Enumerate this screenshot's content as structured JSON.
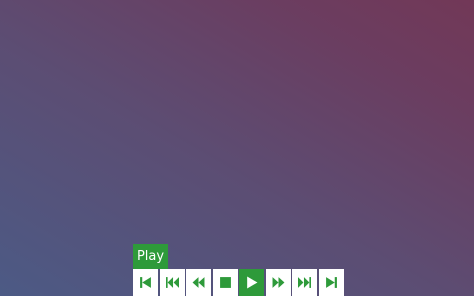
{
  "tooltip": {
    "text": "Play"
  },
  "controls": [
    {
      "name": "skip-to-start-button",
      "icon": "skip-back-icon",
      "active": false
    },
    {
      "name": "previous-track-button",
      "icon": "previous-icon",
      "active": false
    },
    {
      "name": "rewind-button",
      "icon": "rewind-icon",
      "active": false
    },
    {
      "name": "stop-button",
      "icon": "stop-icon",
      "active": false
    },
    {
      "name": "play-button",
      "icon": "play-icon",
      "active": true
    },
    {
      "name": "fast-forward-button",
      "icon": "fast-forward-icon",
      "active": false
    },
    {
      "name": "next-track-button",
      "icon": "next-icon",
      "active": false
    },
    {
      "name": "skip-to-end-button",
      "icon": "skip-forward-icon",
      "active": false
    }
  ],
  "colors": {
    "accent": "#2e9a3a",
    "button_bg": "#ffffff"
  }
}
